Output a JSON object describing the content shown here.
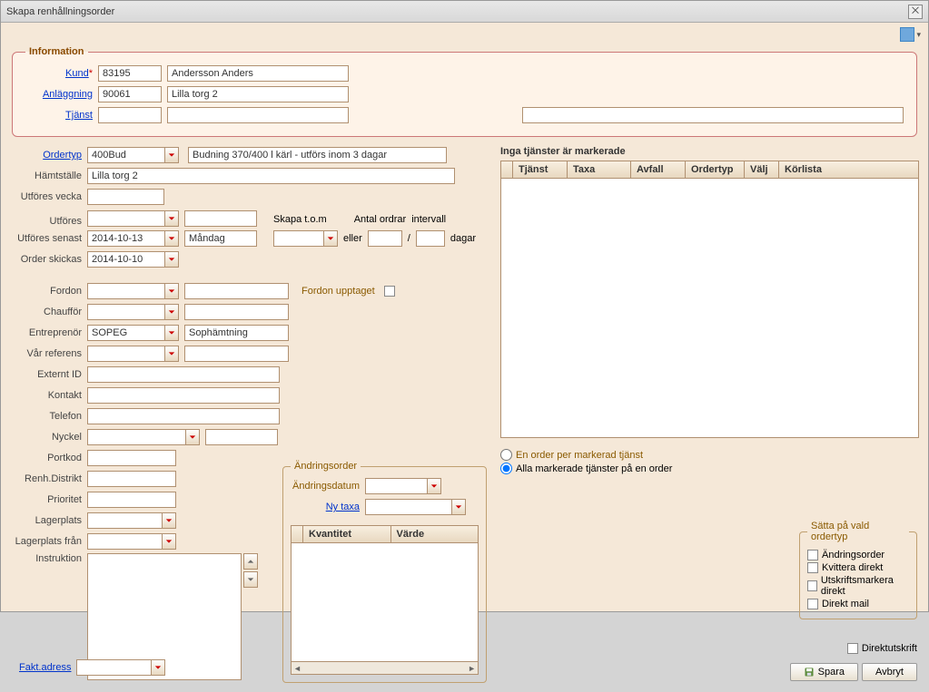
{
  "window": {
    "title": "Skapa renhållningsorder"
  },
  "info": {
    "legend": "Information",
    "kund_label": "Kund",
    "kund_value": "83195",
    "kund_name": "Andersson Anders",
    "anlaggning_label": "Anläggning",
    "anlaggning_value": "90061",
    "anlaggning_name": "Lilla torg 2",
    "tjanst_label": "Tjänst",
    "tjanst_value": "",
    "tjanst_name": "",
    "tjanst_desc": ""
  },
  "form": {
    "ordertyp_label": "Ordertyp",
    "ordertyp_value": "400Bud",
    "ordertyp_desc": "Budning 370/400 l kärl - utförs inom 3 dagar",
    "hamtstalle_label": "Hämtställe",
    "hamtstalle_value": "Lilla torg 2",
    "utfores_vecka_label": "Utföres vecka",
    "utfores_vecka_value": "",
    "utfores_label": "Utföres",
    "utfores_value": "",
    "utfores_day": "",
    "utfores_senast_label": "Utföres senast",
    "utfores_senast_value": "2014-10-13",
    "utfores_senast_day": "Måndag",
    "order_skickas_label": "Order skickas",
    "order_skickas_value": "2014-10-10",
    "skapa_tom_label": "Skapa t.o.m",
    "eller_label": "eller",
    "eller_value": "",
    "antal_ordrar_label": "Antal ordrar",
    "antal_ordrar_value": "",
    "slash": "/",
    "intervall_label": "intervall",
    "intervall_value": "",
    "dagar_label": "dagar",
    "fordon_label": "Fordon",
    "fordon_value": "",
    "fordon_upptaget_label": "Fordon upptaget",
    "chauffor_label": "Chaufför",
    "chauffor_value": "",
    "entreprenor_label": "Entreprenör",
    "entreprenor_value": "SOPEG",
    "entreprenor_name": "Sophämtning",
    "var_referens_label": "Vår referens",
    "var_referens_value": "",
    "externt_id_label": "Externt ID",
    "externt_id_value": "",
    "kontakt_label": "Kontakt",
    "kontakt_value": "",
    "telefon_label": "Telefon",
    "telefon_value": "",
    "nyckel_label": "Nyckel",
    "nyckel_value": "",
    "nyckel_extra": "",
    "portkod_label": "Portkod",
    "portkod_value": "",
    "renh_distrikt_label": "Renh.Distrikt",
    "renh_distrikt_value": "",
    "prioritet_label": "Prioritet",
    "prioritet_value": "",
    "lagerplats_label": "Lagerplats",
    "lagerplats_value": "",
    "lagerplats_fran_label": "Lagerplats från",
    "lagerplats_fran_value": "",
    "instruktion_label": "Instruktion",
    "instruktion_value": "",
    "fakt_adress_label": "Fakt.adress",
    "fakt_adress_value": ""
  },
  "andring": {
    "legend": "Ändringsorder",
    "andringsdatum_label": "Ändringsdatum",
    "andringsdatum_value": "",
    "ny_taxa_label": "Ny taxa",
    "ny_taxa_value": "",
    "col_kvantitet": "Kvantitet",
    "col_varde": "Värde"
  },
  "right": {
    "heading": "Inga tjänster är markerade",
    "col_tjanst": "Tjänst",
    "col_taxa": "Taxa",
    "col_avfall": "Avfall",
    "col_ordertyp": "Ordertyp",
    "col_valj": "Välj",
    "col_korlista": "Körlista",
    "radio_en_label": "En order per markerad tjänst",
    "radio_alla_label": "Alla markerade tjänster på en order"
  },
  "satta": {
    "legend": "Sätta på vald ordertyp",
    "andringsorder": "Ändringsorder",
    "kvittera": "Kvittera direkt",
    "utskrift": "Utskriftsmarkera direkt",
    "direkt_mail": "Direkt mail"
  },
  "bottom": {
    "direktutskrift": "Direktutskrift",
    "spara": "Spara",
    "avbryt": "Avbryt"
  }
}
